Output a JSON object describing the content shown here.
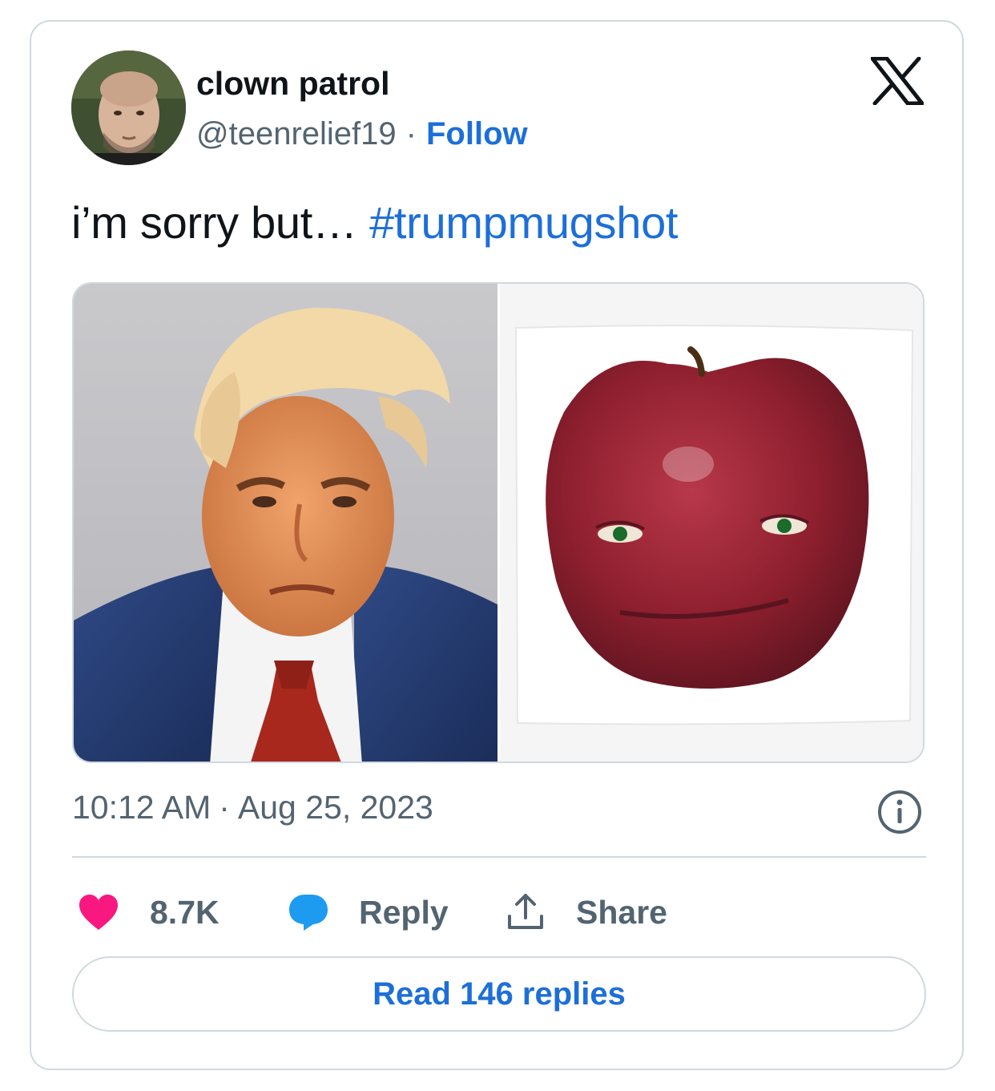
{
  "author": {
    "display_name": "clown patrol",
    "handle": "@teenrelief19",
    "separator": "·",
    "follow_label": "Follow"
  },
  "tweet": {
    "text": "i’m sorry but… ",
    "hashtag": "#trumpmugshot"
  },
  "timestamp": {
    "time": "10:12 AM",
    "separator": "·",
    "date": "Aug 25, 2023"
  },
  "actions": {
    "like_count": "8.7K",
    "reply_label": "Reply",
    "share_label": "Share"
  },
  "read_replies_label": "Read 146 replies",
  "icons": {
    "brand": "x-logo-icon",
    "info": "info-icon",
    "like": "heart-icon",
    "reply": "speech-bubble-icon",
    "share": "share-upload-icon"
  },
  "colors": {
    "link_blue": "#1d6fd8",
    "heart_pink": "#f91880",
    "reply_blue": "#1d9bf0",
    "muted_text": "#536471",
    "border": "#cfd9de"
  }
}
